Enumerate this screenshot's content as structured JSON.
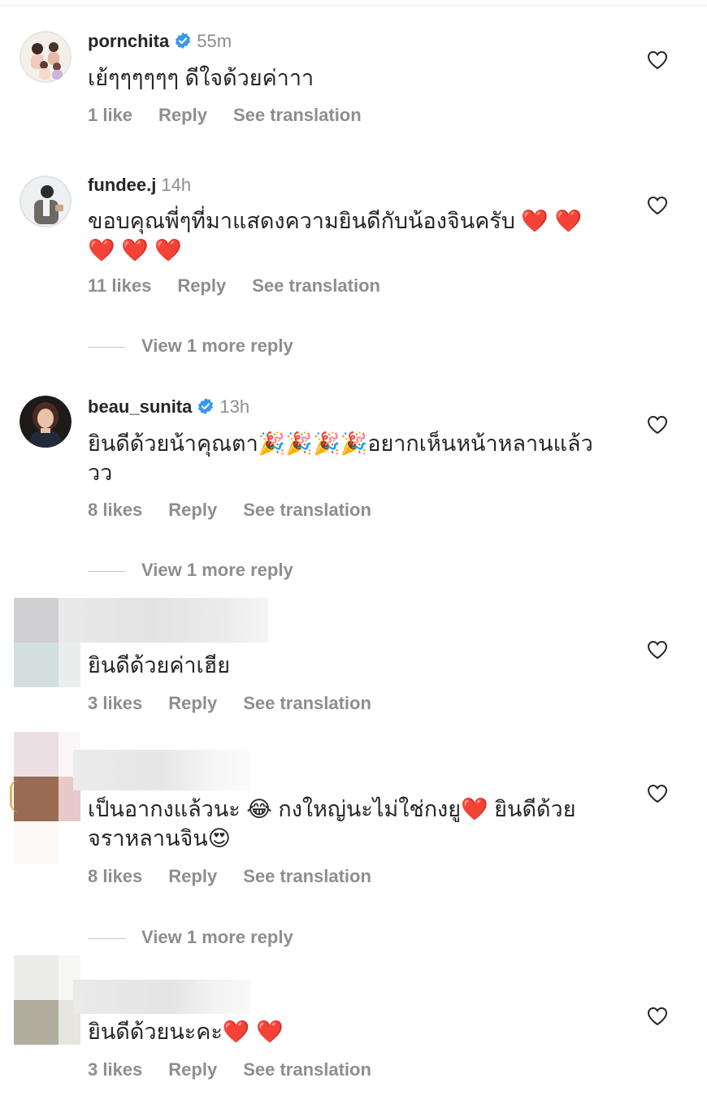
{
  "comments": [
    {
      "username": "pornchita",
      "verified": true,
      "time": "55m",
      "text": "เย้ๆๆๆๆๆๆ ดีใจด้วยค่าาา",
      "likes": "1 like",
      "reply": "Reply",
      "translate": "See translation"
    },
    {
      "username": "fundee.j",
      "verified": false,
      "time": "14h",
      "text": "ขอบคุณพี่ๆที่มาแสดงความยินดีกับน้องจินครับ ❤️ ❤️ ❤️ ❤️ ❤️",
      "likes": "11 likes",
      "reply": "Reply",
      "translate": "See translation",
      "more_replies": "View 1 more reply"
    },
    {
      "username": "beau_sunita",
      "verified": true,
      "time": "13h",
      "text": "ยินดีด้วยน้าคุณตา🎉🎉🎉🎉อยากเห็นหน้าหลานแล้ววว",
      "likes": "8 likes",
      "reply": "Reply",
      "translate": "See translation",
      "more_replies": "View 1 more reply"
    },
    {
      "username": "",
      "verified": false,
      "time": "",
      "text": "ยินดีด้วยค่าเฮีย",
      "likes": "3 likes",
      "reply": "Reply",
      "translate": "See translation"
    },
    {
      "username": "",
      "verified": false,
      "time": "",
      "text": "เป็นอากงแล้วนะ 😂 กงใหญ่นะไม่ใช่กงยู❤️ ยินดีด้วยจราหลานจิน😍",
      "likes": "8 likes",
      "reply": "Reply",
      "translate": "See translation",
      "more_replies": "View 1 more reply"
    },
    {
      "username": "",
      "verified": false,
      "time": "",
      "text": "ยินดีด้วยนะคะ❤️ ❤️",
      "likes": "3 likes",
      "reply": "Reply",
      "translate": "See translation"
    }
  ],
  "colors": {
    "text": "#262626",
    "secondary": "#8e8e8e",
    "verified": "#3897f0"
  },
  "icons": {
    "like": "heart-outline-icon",
    "verified": "verified-badge-icon"
  }
}
